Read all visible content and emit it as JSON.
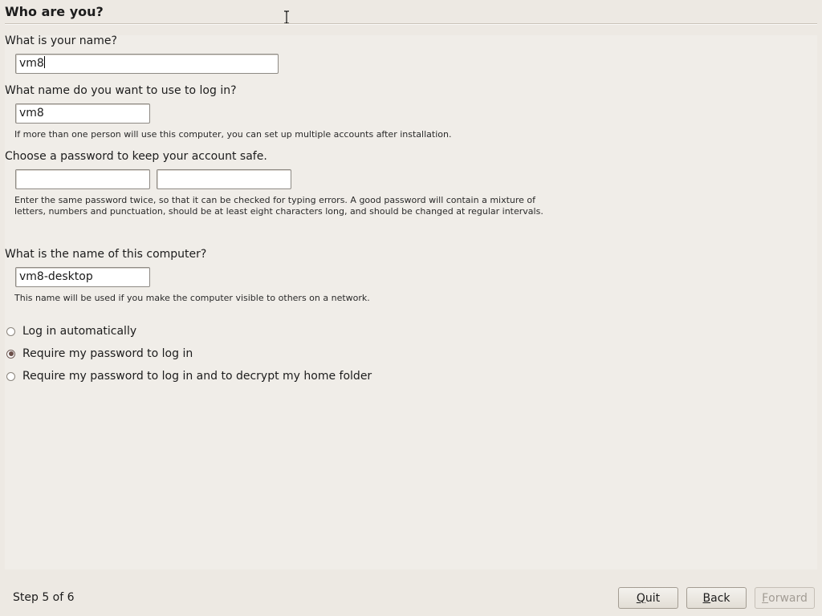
{
  "page": {
    "title": "Who are you?"
  },
  "name": {
    "question": "What is your name?",
    "value": "vm8"
  },
  "login": {
    "question": "What name do you want to use to log in?",
    "value": "vm8",
    "hint": "If more than one person will use this computer, you can set up multiple accounts after installation."
  },
  "password": {
    "question": "Choose a password to keep your account safe.",
    "value": "",
    "confirm_value": "",
    "hint": "Enter the same password twice, so that it can be checked for typing errors. A good password will contain a mixture of letters, numbers and punctuation, should be at least eight characters long, and should be changed at regular intervals."
  },
  "computer": {
    "question": "What is the name of this computer?",
    "value": "vm8-desktop",
    "hint": "This name will be used if you make the computer visible to others on a network."
  },
  "login_options": [
    {
      "label": "Log in automatically",
      "checked": false
    },
    {
      "label": "Require my password to log in",
      "checked": true
    },
    {
      "label": "Require my password to log in and to decrypt my home folder",
      "checked": false
    }
  ],
  "footer": {
    "step": "Step 5 of 6",
    "quit": {
      "mnemonic": "Q",
      "rest": "uit"
    },
    "back": {
      "mnemonic": "B",
      "rest": "ack"
    },
    "forward": {
      "mnemonic": "F",
      "rest": "orward",
      "enabled": false
    }
  },
  "colors": {
    "window_bg": "#ede9e3",
    "content_bg": "#f0ede8",
    "radio_selected": "#6b4f48"
  }
}
